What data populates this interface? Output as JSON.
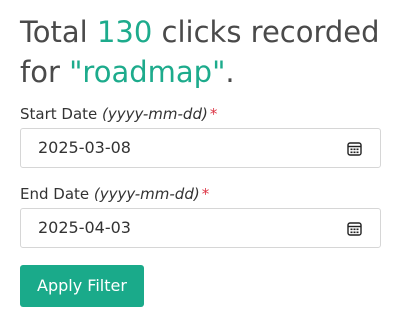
{
  "headline": {
    "prefix": "Total ",
    "count": "130",
    "middle": " clicks recorded for ",
    "term": "\"roadmap\"",
    "suffix": "."
  },
  "start_date": {
    "label": "Start Date",
    "hint": "(yyyy-mm-dd)",
    "required_mark": "*",
    "value": "2025-03-08",
    "icon": "calendar-icon"
  },
  "end_date": {
    "label": "End Date",
    "hint": "(yyyy-mm-dd)",
    "required_mark": "*",
    "value": "2025-04-03",
    "icon": "calendar-icon"
  },
  "apply_button": {
    "label": "Apply Filter"
  },
  "colors": {
    "accent": "#1dab8c",
    "button": "#1aaa8a",
    "required": "#dc3545"
  }
}
